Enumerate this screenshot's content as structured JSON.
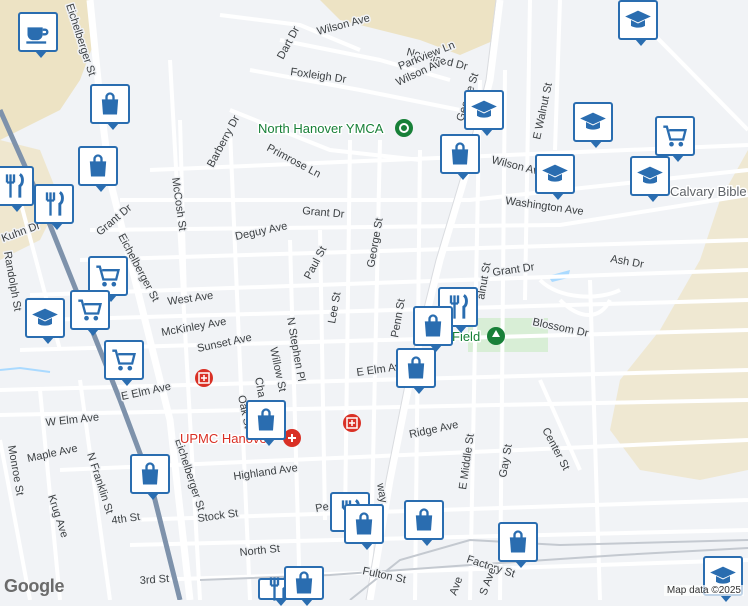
{
  "map": {
    "attribution": "Map data ©2025",
    "logo": "Google",
    "landmarks": {
      "ymca": "North Hanover YMCA",
      "hospital": "UPMC Hanover",
      "field": "Field",
      "calvary": "Calvary Bible"
    },
    "streets": {
      "wilson_ave_top": "Wilson Ave",
      "dart_dr": "Dart Dr",
      "foxleigh_dr": "Foxleigh Dr",
      "northland_dr": "Northland Dr",
      "parkview_ln": "Parkview Ln",
      "wilson_ave_mid": "Wilson Ave",
      "george_st_n": "George St",
      "barberry_dr": "Barberry Dr",
      "primrose_ln": "Primrose Ln",
      "mccosh_st": "McCosh St",
      "wilson_ave_e": "Wilson Ave",
      "e_walnut_st": "E Walnut St",
      "washington_ave": "Washington Ave",
      "grant_dr_w": "Grant Dr",
      "grant_dr_c": "Grant Dr",
      "grant_dr_e": "Grant Dr",
      "kuhn_dr": "Kuhn Dr",
      "eichelberger_st_top": "Eichelberger St",
      "eichelberger_st_mid": "Eichelberger St",
      "eichelberger_st_s": "Eichelberger St",
      "deguy_ave": "Deguy Ave",
      "george_st": "George St",
      "randolph_st": "Randolph St",
      "paul_st": "Paul St",
      "ash_dr": "Ash Dr",
      "west_ave": "West Ave",
      "lee_st": "Lee St",
      "penn_st": "Penn St",
      "walnut_st_s": "alnut St",
      "mckinley_ave": "McKinley Ave",
      "blossom_dr": "Blossom Dr",
      "sunset_ave": "Sunset Ave",
      "n_stephen_pl": "N Stephen Pl",
      "willow_st": "Willow St",
      "cha": "Cha",
      "e_elm_ave": "E Elm Ave",
      "e_elm_ave_e": "E Elm Av",
      "w_elm_ave": "W Elm Ave",
      "oak_st": "Oak St",
      "ridge_ave": "Ridge Ave",
      "center_st": "Center St",
      "maple_ave": "Maple Ave",
      "monroe_st": "Monroe St",
      "n_franklin_st": "N Franklin St",
      "highland_ave": "Highland Ave",
      "e_middle_st": "E Middle St",
      "gay_st": "Gay St",
      "krug_ave": "Krug Ave",
      "fourth_st": "4th St",
      "stock_st": "Stock St",
      "pe": "Pe",
      "way": "way",
      "north_st": "North St",
      "factory_st": "Factory St",
      "third_st": "3rd St",
      "fulton_st": "Fulton St",
      "ave": "Ave",
      "s_ave": "S Ave"
    },
    "pins": [
      {
        "id": "cafe-1",
        "icon": "coffee-cup-icon"
      },
      {
        "id": "shop-1",
        "icon": "shopping-bag-icon"
      },
      {
        "id": "school-1",
        "icon": "graduation-cap-icon"
      },
      {
        "id": "shop-2",
        "icon": "shopping-bag-icon"
      },
      {
        "id": "school-2",
        "icon": "graduation-cap-icon"
      },
      {
        "id": "school-3",
        "icon": "graduation-cap-icon"
      },
      {
        "id": "cart-1",
        "icon": "shopping-cart-icon"
      },
      {
        "id": "shop-3",
        "icon": "shopping-bag-icon"
      },
      {
        "id": "school-4",
        "icon": "graduation-cap-icon"
      },
      {
        "id": "school-5",
        "icon": "graduation-cap-icon"
      },
      {
        "id": "restaurant-1",
        "icon": "fork-knife-icon"
      },
      {
        "id": "restaurant-2",
        "icon": "fork-knife-icon"
      },
      {
        "id": "cart-2",
        "icon": "shopping-cart-icon"
      },
      {
        "id": "cart-3",
        "icon": "shopping-cart-icon"
      },
      {
        "id": "school-6",
        "icon": "graduation-cap-icon"
      },
      {
        "id": "restaurant-3",
        "icon": "fork-knife-icon"
      },
      {
        "id": "shop-4",
        "icon": "shopping-bag-icon"
      },
      {
        "id": "cart-4",
        "icon": "shopping-cart-icon"
      },
      {
        "id": "shop-5",
        "icon": "shopping-bag-icon"
      },
      {
        "id": "shop-6",
        "icon": "shopping-bag-icon"
      },
      {
        "id": "shop-7",
        "icon": "shopping-bag-icon"
      },
      {
        "id": "shop-8",
        "icon": "shopping-bag-icon"
      },
      {
        "id": "restaurant-4",
        "icon": "fork-knife-icon"
      },
      {
        "id": "shop-9",
        "icon": "shopping-bag-icon"
      },
      {
        "id": "shop-10",
        "icon": "shopping-bag-icon"
      },
      {
        "id": "school-7",
        "icon": "graduation-cap-icon"
      },
      {
        "id": "restaurant-5",
        "icon": "fork-knife-icon"
      },
      {
        "id": "shop-11",
        "icon": "shopping-bag-icon"
      }
    ],
    "colors": {
      "pin_border": "#2a6db0",
      "hospital": "#d93025",
      "park": "#188038",
      "rail": "#5f7fa8",
      "water": "#aadaff"
    }
  }
}
